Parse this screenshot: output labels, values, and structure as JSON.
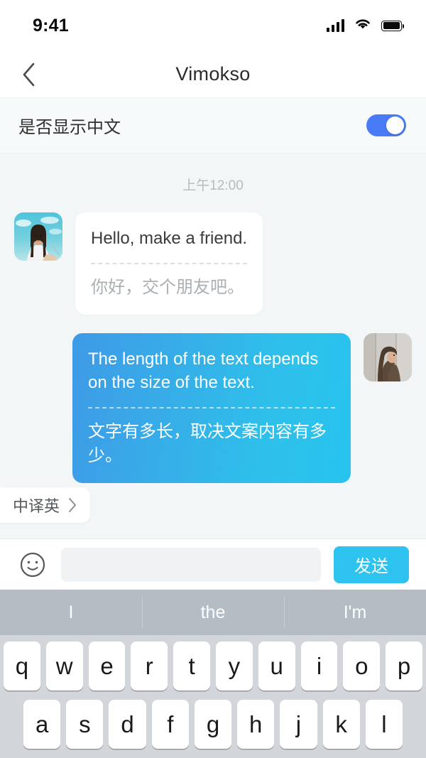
{
  "status_bar": {
    "time": "9:41",
    "signal_icon": "signal-bars-icon",
    "wifi_icon": "wifi-icon",
    "battery_icon": "battery-full-icon"
  },
  "navbar": {
    "back_icon": "chevron-left-icon",
    "title": "Vimoksо"
  },
  "settings_row": {
    "label": "是否显示中文",
    "toggle_state": "on",
    "toggle_color": "#4a7bf7"
  },
  "chat": {
    "timestamp": "上午12:00",
    "messages": [
      {
        "direction": "incoming",
        "avatar_icon": "avatar-woman-sky-photo",
        "text_en": "Hello, make a friend.",
        "text_zh": "你好，交个朋友吧。"
      },
      {
        "direction": "outgoing",
        "avatar_icon": "avatar-woman-wall-photo",
        "text_en": "The length of the text depends on the size of the text.",
        "text_zh": "文字有多长，取决文案内容有多少。",
        "bubble_gradient_from": "#3f9ae6",
        "bubble_gradient_to": "#27c4ee"
      }
    ],
    "translate_chip": {
      "label": "中译英",
      "chevron_icon": "chevron-right-icon"
    }
  },
  "input_bar": {
    "emoji_icon": "smiley-face-icon",
    "input_value": "",
    "input_placeholder": "",
    "send_label": "发送",
    "send_color": "#2ec3ef"
  },
  "keyboard": {
    "suggestions": [
      "I",
      "the",
      "I'm"
    ],
    "row1": [
      "q",
      "w",
      "e",
      "r",
      "t",
      "y",
      "u",
      "i",
      "o",
      "p"
    ],
    "row2": [
      "a",
      "s",
      "d",
      "f",
      "g",
      "h",
      "j",
      "k",
      "l"
    ]
  }
}
